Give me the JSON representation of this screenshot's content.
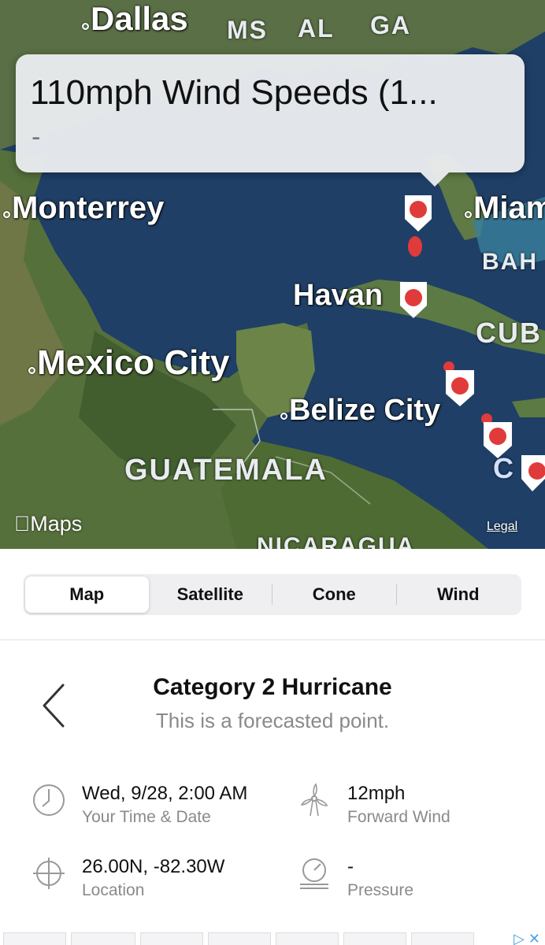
{
  "map": {
    "callout": {
      "title": "110mph Wind Speeds (1...",
      "subtitle": "-"
    },
    "cities": {
      "dallas": "Dallas",
      "monterrey": "Monterrey",
      "miami": "Miam",
      "havana": "Havan",
      "mexico_city": "Mexico City",
      "belize_city": "Belize City"
    },
    "regions": {
      "ms": "MS",
      "al": "AL",
      "ga": "GA",
      "bahamas": "BAH",
      "cuba": "CUB",
      "guatemala": "GUATEMALA",
      "nicaragua": "NICARAGUA",
      "partial_c": "C"
    },
    "branding": {
      "maps": "Maps",
      "legal": "Legal"
    },
    "colors": {
      "marker": "#e03b3b",
      "water": "#1f3f66",
      "land": "#4f6b3a"
    }
  },
  "tabs": [
    {
      "label": "Map",
      "active": true
    },
    {
      "label": "Satellite",
      "active": false
    },
    {
      "label": "Cone",
      "active": false
    },
    {
      "label": "Wind",
      "active": false
    }
  ],
  "details": {
    "title": "Category 2 Hurricane",
    "subtitle": "This is a forecasted point.",
    "datetime": {
      "value": "Wed, 9/28, 2:00 AM",
      "label": "Your Time & Date",
      "icon": "clock-icon"
    },
    "forward_wind": {
      "value": "12mph",
      "label": "Forward Wind",
      "icon": "wind-turbine-icon"
    },
    "location": {
      "value": "26.00N, -82.30W",
      "label": "Location",
      "icon": "crosshair-icon"
    },
    "pressure": {
      "value": "-",
      "label": "Pressure",
      "icon": "barometer-icon"
    }
  }
}
